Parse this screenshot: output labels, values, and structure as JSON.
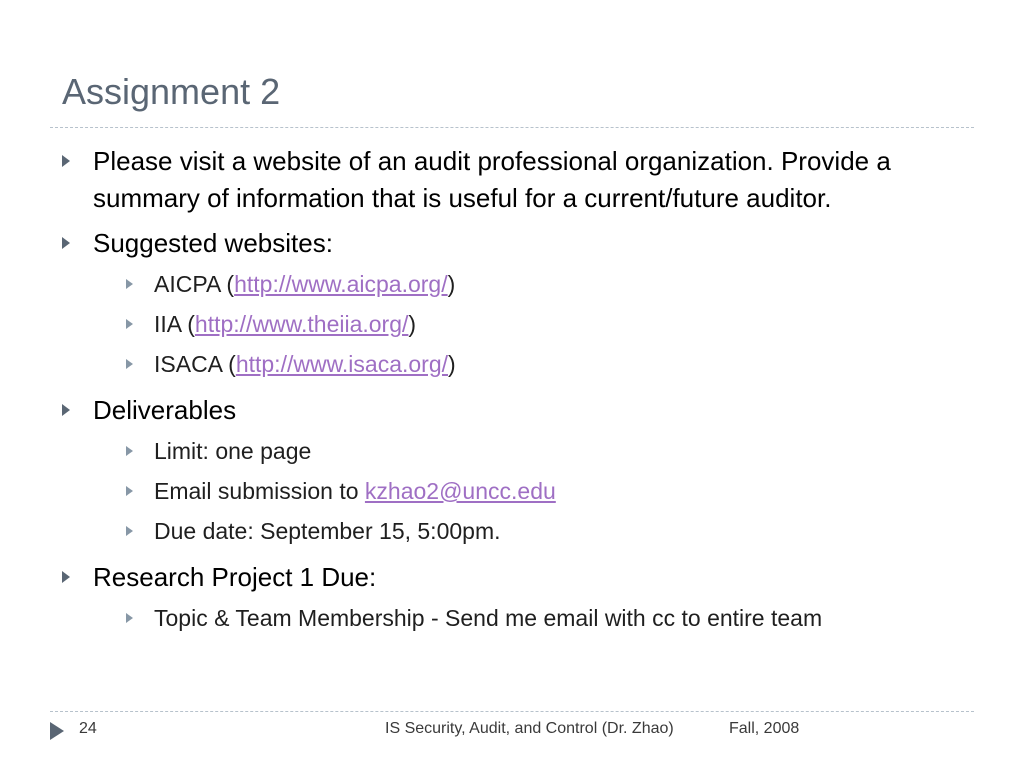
{
  "slide": {
    "title": "Assignment 2",
    "items": [
      {
        "text": "Please visit a website of an audit professional organization. Provide a summary of information that is useful for a current/future auditor."
      },
      {
        "text": "Suggested websites:",
        "subitems": [
          {
            "prefix": "AICPA (",
            "link": "http://www.aicpa.org/",
            "suffix": ")"
          },
          {
            "prefix": "IIA (",
            "link": "http://www.theiia.org/",
            "suffix": ")"
          },
          {
            "prefix": "ISACA (",
            "link": "http://www.isaca.org/",
            "suffix": ")"
          }
        ]
      },
      {
        "text": "Deliverables",
        "subitems": [
          {
            "text": "Limit: one page"
          },
          {
            "prefix": "Email submission to ",
            "link": "kzhao2@uncc.edu"
          },
          {
            "text": "Due date: September 15, 5:00pm."
          }
        ]
      },
      {
        "text": "Research Project 1 Due:",
        "subitems": [
          {
            "text": "Topic & Team Membership - Send me email with cc to entire team"
          }
        ]
      }
    ]
  },
  "footer": {
    "page_number": "24",
    "course": "IS Security, Audit, and Control (Dr. Zhao)",
    "term": "Fall, 2008"
  },
  "colors": {
    "title": "#5a6674",
    "link": "#9f6fc4",
    "bullet": "#5a6674",
    "rule": "#b7c2cc"
  },
  "icons": {
    "level1_bullet": "triangle-right-icon",
    "level2_bullet": "triangle-right-icon",
    "footer_marker": "triangle-right-icon"
  }
}
